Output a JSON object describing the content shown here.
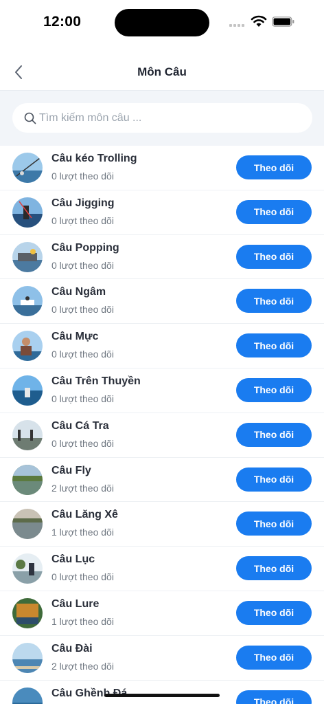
{
  "status_bar": {
    "time": "12:00"
  },
  "nav": {
    "title": "Môn Câu"
  },
  "search": {
    "placeholder": "Tìm kiếm môn câu ..."
  },
  "items": [
    {
      "name": "Câu kéo Trolling",
      "followers": "0 lượt theo dõi",
      "button": "Theo dõi"
    },
    {
      "name": "Câu Jigging",
      "followers": "0 lượt theo dõi",
      "button": "Theo dõi"
    },
    {
      "name": "Câu Popping",
      "followers": "0 lượt theo dõi",
      "button": "Theo dõi"
    },
    {
      "name": "Câu Ngâm",
      "followers": "0 lượt theo dõi",
      "button": "Theo dõi"
    },
    {
      "name": "Câu Mực",
      "followers": "0 lượt theo dõi",
      "button": "Theo dõi"
    },
    {
      "name": "Câu Trên Thuyền",
      "followers": "0 lượt theo dõi",
      "button": "Theo dõi"
    },
    {
      "name": "Câu Cá Tra",
      "followers": "0 lượt theo dõi",
      "button": "Theo dõi"
    },
    {
      "name": "Câu Fly",
      "followers": "2 lượt theo dõi",
      "button": "Theo dõi"
    },
    {
      "name": "Câu Lăng Xê",
      "followers": "1 lượt theo dõi",
      "button": "Theo dõi"
    },
    {
      "name": "Câu Lục",
      "followers": "0 lượt theo dõi",
      "button": "Theo dõi"
    },
    {
      "name": "Câu Lure",
      "followers": "1 lượt theo dõi",
      "button": "Theo dõi"
    },
    {
      "name": "Câu Đài",
      "followers": "2 lượt theo dõi",
      "button": "Theo dõi"
    },
    {
      "name": "Câu Ghềnh Đá",
      "followers": "",
      "button": "Theo dõi"
    }
  ],
  "colors": {
    "accent": "#1a7cf0",
    "search_bg": "#f2f5f9"
  }
}
